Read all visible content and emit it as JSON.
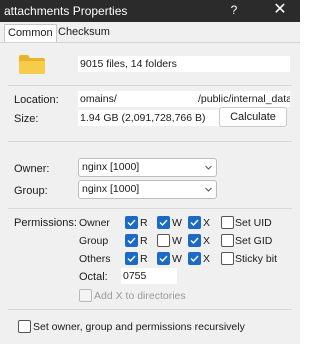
{
  "window": {
    "title": "attachments Properties",
    "help_glyph": "?",
    "close_glyph": "✕"
  },
  "tabs": [
    {
      "label": "Common",
      "active": true
    },
    {
      "label": "Checksum",
      "active": false
    }
  ],
  "summary": "9015 files, 14 folders",
  "location": {
    "label": "Location:",
    "value_left": "omains/",
    "value_right": "/public/internal_data"
  },
  "size": {
    "label": "Size:",
    "value": "1.94 GB (2,091,728,766 B)",
    "calculate_label": "Calculate"
  },
  "owner": {
    "label": "Owner:",
    "value": "nginx [1000]"
  },
  "group": {
    "label": "Group:",
    "value": "nginx [1000]"
  },
  "permissions": {
    "label": "Permissions:",
    "rows": [
      {
        "who": "Owner",
        "r": true,
        "w": true,
        "x": true,
        "extra_label": "Set UID",
        "extra": false
      },
      {
        "who": "Group",
        "r": true,
        "w": false,
        "x": true,
        "extra_label": "Set GID",
        "extra": false
      },
      {
        "who": "Others",
        "r": true,
        "w": true,
        "x": true,
        "extra_label": "Sticky bit",
        "extra": false
      }
    ],
    "r_label": "R",
    "w_label": "W",
    "x_label": "X",
    "octal_label": "Octal:",
    "octal_value": "0755",
    "add_x_label": "Add X to directories"
  },
  "recursive_label": "Set owner, group and permissions recursively",
  "colors": {
    "accent": "#1b6ac6",
    "titlebar": "#2b2b2b",
    "folder": "#f0c43c"
  },
  "icons": {
    "folder": "folder-icon",
    "help": "help-icon",
    "close": "close-icon",
    "chevron": "chevron-down-icon"
  }
}
